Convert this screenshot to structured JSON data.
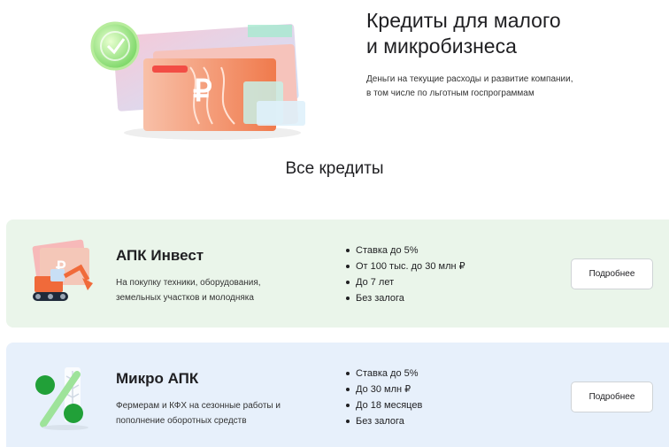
{
  "hero": {
    "title_line1": "Кредиты для малого",
    "title_line2": "и микробизнеса",
    "subtitle_line1": "Деньги на текущие расходы и развитие компании,",
    "subtitle_line2": "в том числе по льготным госпрограммам"
  },
  "section": {
    "title": "Все кредиты"
  },
  "cards": [
    {
      "title": "АПК Инвест",
      "desc_line1": "На покупку техники, оборудования,",
      "desc_line2": "земельных участков и молодняка",
      "features": [
        "Ставка до 5%",
        "От 100 тыс.  до 30 млн ₽",
        "До 7 лет",
        "Без залога"
      ],
      "button": "Подробнее",
      "icon": "excavator-banknote-icon"
    },
    {
      "title": "Микро АПК",
      "desc_line1": "Фермерам и КФХ на сезонные работы и",
      "desc_line2": "пополнение оборотных средств",
      "features": [
        "Ставка до 5%",
        "До 30 млн ₽",
        "До 18 месяцев",
        "Без залога"
      ],
      "button": "Подробнее",
      "icon": "percent-wheat-icon"
    }
  ],
  "colors": {
    "card1_bg": "#eaf5ea",
    "card2_bg": "#e7f0fb",
    "accent_green": "#21a038",
    "accent_orange": "#f06a3a"
  }
}
